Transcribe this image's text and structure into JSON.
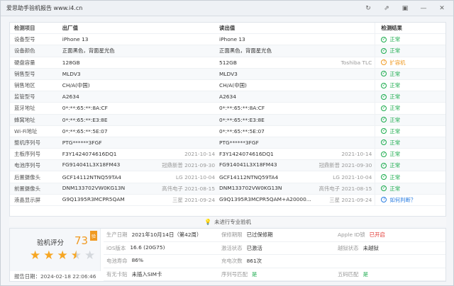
{
  "window": {
    "title": "爱思助手验机报告 www.i4.cn"
  },
  "table": {
    "headers": {
      "label": "检测项目",
      "factory": "出厂值",
      "read": "读出值",
      "result": "检测结果"
    },
    "rows": [
      {
        "label": "设备型号",
        "factory": "iPhone 13",
        "factory_note": "",
        "read": "iPhone 13",
        "read_note": "",
        "status": "ok",
        "result": "正常"
      },
      {
        "label": "设备颜色",
        "factory": "正面黑色，背面星光色",
        "factory_note": "",
        "read": "正面黑色，背面星光色",
        "read_note": "",
        "status": "ok",
        "result": "正常"
      },
      {
        "label": "硬盘容量",
        "factory": "128GB",
        "factory_note": "",
        "read": "512GB",
        "read_note": "Toshiba TLC",
        "status": "warn",
        "result": "扩容机"
      },
      {
        "label": "销售型号",
        "factory": "MLDV3",
        "factory_note": "",
        "read": "MLDV3",
        "read_note": "",
        "status": "ok",
        "result": "正常"
      },
      {
        "label": "销售地区",
        "factory": "CH/A(中国)",
        "factory_note": "",
        "read": "CH/A(中国)",
        "read_note": "",
        "status": "ok",
        "result": "正常"
      },
      {
        "label": "监管型号",
        "factory": "A2634",
        "factory_note": "",
        "read": "A2634",
        "read_note": "",
        "status": "ok",
        "result": "正常"
      },
      {
        "label": "蓝牙地址",
        "factory": "0*:**:65:**:8A:CF",
        "factory_note": "",
        "read": "0*:**:65:**:8A:CF",
        "read_note": "",
        "status": "ok",
        "result": "正常"
      },
      {
        "label": "蜂窝地址",
        "factory": "0*:**:65:**:E3:8E",
        "factory_note": "",
        "read": "0*:**:65:**:E3:8E",
        "read_note": "",
        "status": "ok",
        "result": "正常"
      },
      {
        "label": "Wi-Fi地址",
        "factory": "0*:**:65:**:5E:07",
        "factory_note": "",
        "read": "0*:**:65:**:5E:07",
        "read_note": "",
        "status": "ok",
        "result": "正常"
      },
      {
        "label": "整机序列号",
        "factory": "PTG******3FGF",
        "factory_note": "",
        "read": "PTG******3FGF",
        "read_note": "",
        "status": "ok",
        "result": "正常"
      },
      {
        "label": "主板序列号",
        "factory": "F3Y1424074616DQ1",
        "factory_note": "2021-10-14",
        "read": "F3Y1424074616DQ1",
        "read_note": "2021-10-14",
        "status": "ok",
        "result": "正常"
      },
      {
        "label": "电池序列号",
        "factory": "FG914041L3X18FM43",
        "factory_note": "冠鼎新普 2021-09-30",
        "read": "FG914041L3X18FM43",
        "read_note": "冠鼎新普 2021-09-30",
        "status": "ok",
        "result": "正常"
      },
      {
        "label": "后置摄像头",
        "factory": "GCF14112NTNQ59TA4",
        "factory_note": "LG 2021-10-04",
        "read": "GCF14112NTNQ59TA4",
        "read_note": "LG 2021-10-04",
        "status": "ok",
        "result": "正常"
      },
      {
        "label": "前置摄像头",
        "factory": "DNM133702VW0KG13N",
        "factory_note": "高伟电子 2021-08-15",
        "read": "DNM133702VW0KG13N",
        "read_note": "高伟电子 2021-08-15",
        "status": "ok",
        "result": "正常"
      },
      {
        "label": "液晶显示屏",
        "factory": "G9Q1395R3MCPR5QAM",
        "factory_note": "三星 2021-09-24",
        "read": "G9Q1395R3MCPR5QAM+A20000...",
        "read_note": "三星 2021-09-24",
        "status": "question",
        "result": "如何判断？"
      }
    ]
  },
  "banner": {
    "text": "未进行专业验机"
  },
  "summary": {
    "score_label": "验机评分",
    "score_value": "73",
    "badge": "验",
    "rating": 3.5,
    "report_date_label": "报告日期：",
    "report_date": "2024-02-18 22:06:46",
    "rows": [
      [
        {
          "label": "生产日期",
          "value": "2021年10月14日（第42周）",
          "color": ""
        },
        {
          "label": "保修期限",
          "value": "已过保修期",
          "color": ""
        },
        {
          "label": "Apple ID锁",
          "value": "已开启",
          "color": "#e0302b"
        }
      ],
      [
        {
          "label": "iOS版本",
          "value": "16.6 (20G75)",
          "color": ""
        },
        {
          "label": "激活状态",
          "value": "已激活",
          "color": ""
        },
        {
          "label": "越狱状态",
          "value": "未越狱",
          "color": ""
        }
      ],
      [
        {
          "label": "电池寿命",
          "value": "86%",
          "color": ""
        },
        {
          "label": "充电次数",
          "value": "861次",
          "color": ""
        },
        {
          "label": "",
          "value": "",
          "color": ""
        }
      ],
      [
        {
          "label": "有无卡贴",
          "value": "未插入SIM卡",
          "color": ""
        },
        {
          "label": "序列号匹配",
          "value": "是",
          "color": "#1aab4c"
        },
        {
          "label": "五码匹配",
          "value": "是",
          "color": "#1aab4c"
        }
      ]
    ]
  },
  "icons": {
    "ok": "check-circle-icon",
    "warn": "warning-circle-icon",
    "question": "question-circle-icon"
  }
}
